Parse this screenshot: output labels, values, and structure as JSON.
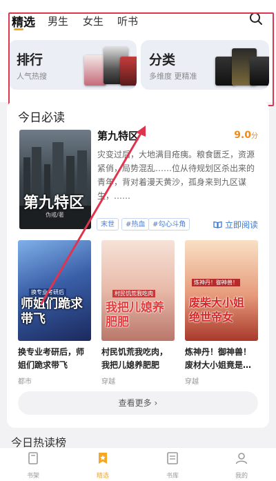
{
  "tabs": [
    {
      "label": "精选",
      "active": true
    },
    {
      "label": "男生",
      "active": false
    },
    {
      "label": "女生",
      "active": false
    },
    {
      "label": "听书",
      "active": false
    }
  ],
  "promos": [
    {
      "title": "排行",
      "subtitle": "人气热搜"
    },
    {
      "title": "分类",
      "subtitle": "多维度 更精准"
    }
  ],
  "today": {
    "title": "今日必读",
    "featured": {
      "title": "第九特区",
      "score": "9.0",
      "score_unit": "分",
      "description": "灾变过后，大地满目疮痍。粮食匮乏，资源紧俏，局势混乱……位从待规划区杀出来的青年，背对着漫天黄沙，孤身来到九区谋生，……",
      "cover_title": "第九特区",
      "cover_author": "伪戒/著",
      "tags": [
        "末世",
        "#热血",
        "#勾心斗角"
      ],
      "read_label": "立即阅读"
    },
    "books": [
      {
        "title": "换专业考研后，师姐们跪求带飞",
        "category": "都市",
        "cover_title": "师姐们跪求带飞",
        "cover_sub": "换专业考研后"
      },
      {
        "title": "村民饥荒我吃肉，我把儿媳养肥肥",
        "category": "穿越",
        "cover_title": "我把儿媳养肥肥",
        "cover_sub": "村民饥荒我吃肉"
      },
      {
        "title": "炼神丹！御神兽！废材大小姐竟是…",
        "category": "穿越",
        "cover_title": "废柴大小姐 绝世帝女",
        "cover_sub": "炼神丹！御神兽！"
      }
    ],
    "more_label": "查看更多"
  },
  "next_section": "今日热读榜",
  "bottom_nav": [
    {
      "label": "书架",
      "active": false,
      "icon": "bookshelf-icon"
    },
    {
      "label": "精选",
      "active": true,
      "icon": "featured-icon"
    },
    {
      "label": "书库",
      "active": false,
      "icon": "library-icon"
    },
    {
      "label": "我的",
      "active": false,
      "icon": "profile-icon"
    }
  ],
  "colors": {
    "accent": "#f5a623",
    "highlight_box": "#e0334d",
    "link": "#3a78d4",
    "score": "#f08a1c"
  }
}
